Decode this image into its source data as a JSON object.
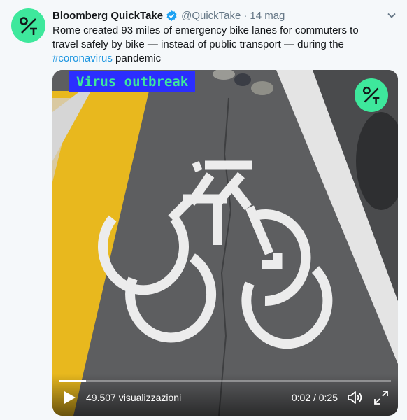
{
  "tweet": {
    "author_name": "Bloomberg QuickTake",
    "handle": "@QuickTake",
    "separator": "·",
    "time": "14 mag",
    "text_before": "Rome created 93 miles of emergency bike lanes for commuters to travel safely by bike — instead of public transport — during the ",
    "hashtag": "#coronavirus",
    "text_after": " pandemic"
  },
  "media": {
    "badge_label": "Virus outbreak",
    "progress": 0.08
  },
  "player": {
    "views": "49.507 visualizzazioni",
    "timecode": "0:02 / 0:25"
  },
  "colors": {
    "brand_green": "#3ee89c",
    "badge_blue": "#2b2eff",
    "link_blue": "#1b95e0",
    "verified_blue": "#1da1f2"
  },
  "icons": {
    "avatar": "quicktake-logo-icon",
    "verified": "verified-badge-icon",
    "caret": "chevron-down-icon",
    "play": "play-icon",
    "volume": "volume-icon",
    "fullscreen": "fullscreen-icon"
  }
}
